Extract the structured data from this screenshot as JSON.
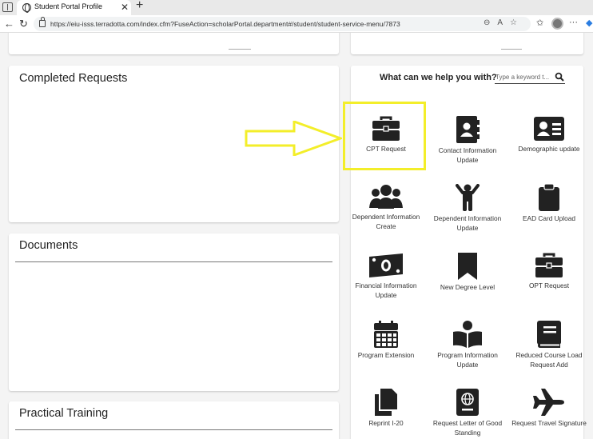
{
  "browser": {
    "tab_title": "Student Portal Profile",
    "url": "https://eiu-isss.terradotta.com/index.cfm?FuseAction=scholarPortal.department#/student/student-service-menu/7873"
  },
  "cards": {
    "completed_requests": "Completed Requests",
    "documents": "Documents",
    "practical_training": "Practical Training"
  },
  "help": {
    "title": "What can we help you with?",
    "search_placeholder": "Type a keyword t..."
  },
  "services": [
    {
      "label": "CPT Request",
      "icon": "briefcase-icon"
    },
    {
      "label": "Contact Information Update",
      "icon": "address-book-icon"
    },
    {
      "label": "Demographic update",
      "icon": "id-card-icon"
    },
    {
      "label": "Dependent Information Create",
      "icon": "users-icon"
    },
    {
      "label": "Dependent Information Update",
      "icon": "child-icon"
    },
    {
      "label": "EAD Card Upload",
      "icon": "clipboard-icon"
    },
    {
      "label": "Financial Information Update",
      "icon": "money-bill-icon"
    },
    {
      "label": "New Degree Level",
      "icon": "bookmark-icon"
    },
    {
      "label": "OPT Request",
      "icon": "briefcase-icon"
    },
    {
      "label": "Program Extension",
      "icon": "calendar-icon"
    },
    {
      "label": "Program Information Update",
      "icon": "book-reader-icon"
    },
    {
      "label": "Reduced Course Load Request Add",
      "icon": "book-icon"
    },
    {
      "label": "Reprint I-20",
      "icon": "copy-icon"
    },
    {
      "label": "Request Letter of Good Standing",
      "icon": "passport-icon"
    },
    {
      "label": "Request Travel Signature",
      "icon": "plane-icon"
    }
  ],
  "annotation": {
    "arrow_color": "#f3ee2a",
    "highlight_color": "#f3ee2a"
  },
  "colors": {
    "icon": "#222222",
    "page_bg": "#f4f4f4",
    "card_bg": "#ffffff"
  }
}
